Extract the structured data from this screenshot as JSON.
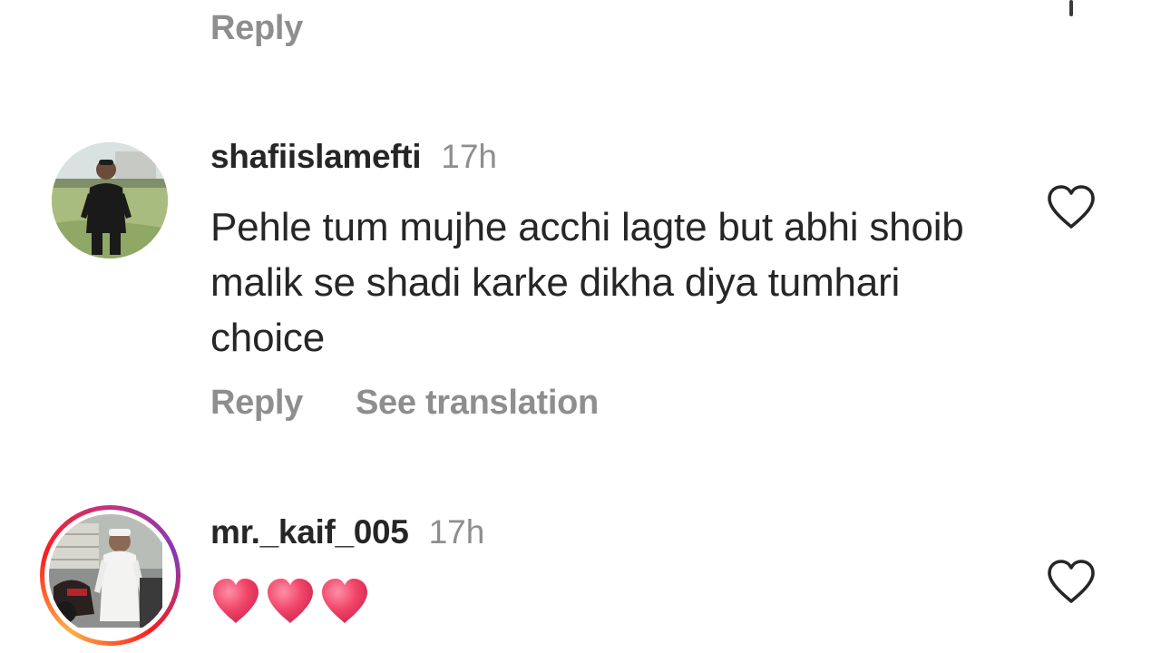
{
  "previous_comment": {
    "reply_label": "Reply"
  },
  "comments": [
    {
      "username": "shafiislamefti",
      "time": "17h",
      "text": "Pehle tum mujhe acchi lagte but abhi shoib malik se shadi karke dikha diya tumhari choice",
      "reply_label": "Reply",
      "translate_label": "See translation",
      "like_icon": "heart-outline-icon",
      "has_story_ring": false
    },
    {
      "username": "mr._kaif_005",
      "time": "17h",
      "text_emoji": [
        "red-heart-emoji",
        "red-heart-emoji",
        "red-heart-emoji"
      ],
      "like_icon": "heart-outline-icon",
      "has_story_ring": true
    }
  ],
  "colors": {
    "primary_text": "#262626",
    "secondary_text": "#8e8e8e",
    "emoji_heart": "#f04468",
    "story_ring": [
      "#c13584",
      "#833ab4",
      "#fd1d1d",
      "#fcb045"
    ]
  }
}
